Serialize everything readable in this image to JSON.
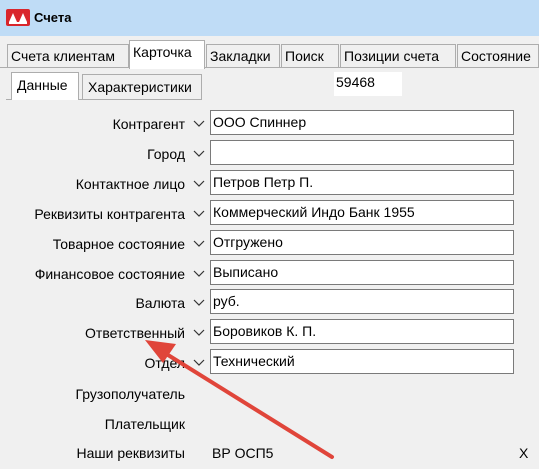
{
  "window": {
    "title": "Счета"
  },
  "tabs": [
    {
      "label": "Счета клиентам"
    },
    {
      "label": "Карточка"
    },
    {
      "label": "Закладки"
    },
    {
      "label": "Поиск"
    },
    {
      "label": "Позиции счета"
    },
    {
      "label": "Состояние"
    }
  ],
  "active_tab": "Карточка",
  "subtabs": [
    {
      "label": "Данные"
    },
    {
      "label": "Характеристики"
    }
  ],
  "active_subtab": "Данные",
  "doc_number": "59468",
  "fields": [
    {
      "label": "Контрагент",
      "value": "ООО Спиннер"
    },
    {
      "label": "Город",
      "value": ""
    },
    {
      "label": "Контактное лицо",
      "value": "Петров Петр П."
    },
    {
      "label": "Реквизиты контрагента",
      "value": "Коммерческий Индо Банк 1955"
    },
    {
      "label": "Товарное состояние",
      "value": "Отгружено"
    },
    {
      "label": "Финансовое состояние",
      "value": "Выписано"
    },
    {
      "label": "Валюта",
      "value": "руб."
    },
    {
      "label": "Ответственный",
      "value": "Боровиков К. П."
    },
    {
      "label": "Отдел",
      "value": "Технический"
    }
  ],
  "static_rows": [
    {
      "label": "Грузополучатель",
      "value": ""
    },
    {
      "label": "Плательщик",
      "value": ""
    },
    {
      "label": "Наши реквизиты",
      "value": "ВР ОСП5",
      "extra": "X"
    }
  ],
  "colors": {
    "titlebar": "#bfdcf6",
    "annotation_arrow": "#e0453a"
  },
  "icons": {
    "app_logo": "app-logo-icon",
    "dropdown": "chevron-down-icon"
  }
}
